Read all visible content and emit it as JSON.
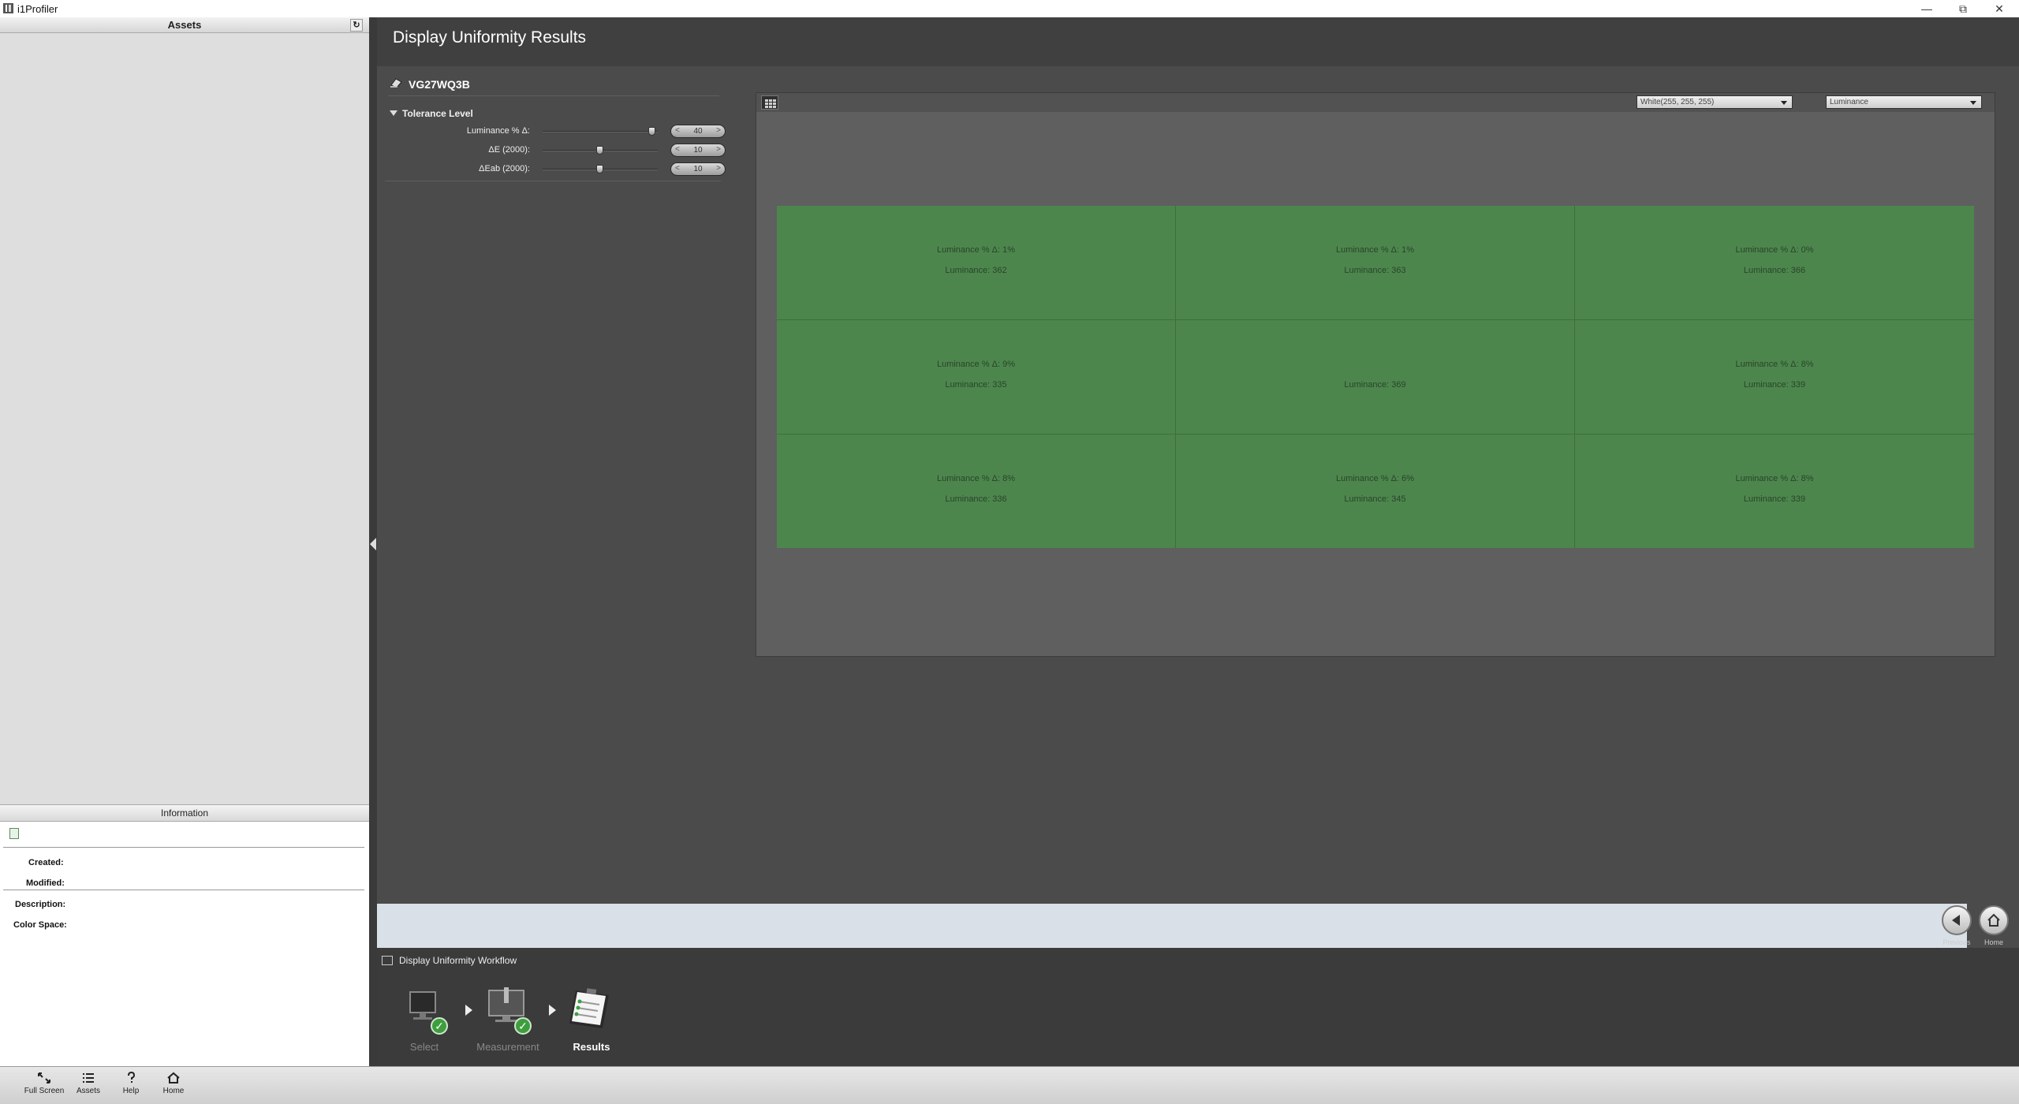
{
  "window": {
    "title": "i1Profiler"
  },
  "left": {
    "assets_header": "Assets",
    "info_header": "Information",
    "info_labels": {
      "created": "Created:",
      "modified": "Modified:",
      "description": "Description:",
      "color_space": "Color Space:"
    }
  },
  "header": {
    "title": "Display Uniformity Results"
  },
  "device": {
    "name": "VG27WQ3B"
  },
  "tolerance": {
    "label": "Tolerance Level",
    "rows": [
      {
        "name": "Luminance % Δ:",
        "value": "40",
        "level": 0.95
      },
      {
        "name": "ΔE (2000):",
        "value": "10",
        "level": 0.5
      },
      {
        "name": "ΔEab (2000):",
        "value": "10",
        "level": 0.5
      }
    ]
  },
  "results": {
    "color_select": "White(255, 255, 255)",
    "metric_select": "Luminance",
    "cells": [
      {
        "delta": "Luminance % Δ:  1%",
        "lum": "Luminance:  362"
      },
      {
        "delta": "Luminance % Δ:  1%",
        "lum": "Luminance:  363"
      },
      {
        "delta": "Luminance % Δ:  0%",
        "lum": "Luminance:  366"
      },
      {
        "delta": "Luminance % Δ:  9%",
        "lum": "Luminance:  335"
      },
      {
        "delta": "",
        "lum": "Luminance:  369"
      },
      {
        "delta": "Luminance % Δ:  8%",
        "lum": "Luminance:  339"
      },
      {
        "delta": "Luminance % Δ:  8%",
        "lum": "Luminance:  336"
      },
      {
        "delta": "Luminance % Δ:  6%",
        "lum": "Luminance:  345"
      },
      {
        "delta": "Luminance % Δ:  8%",
        "lum": "Luminance:  339"
      }
    ],
    "cell_color": "#4d864d"
  },
  "nav": {
    "previous_label": "Previous",
    "home_label": "Home"
  },
  "workflow": {
    "title": "Display Uniformity Workflow",
    "steps": [
      {
        "label": "Select",
        "done": true
      },
      {
        "label": "Measurement",
        "done": true
      },
      {
        "label": "Results",
        "active": true
      }
    ]
  },
  "bottombar": {
    "items": [
      {
        "label": "Full Screen",
        "icon": "fullscreen-icon"
      },
      {
        "label": "Assets",
        "icon": "list-icon"
      },
      {
        "label": "Help",
        "icon": "question-icon"
      },
      {
        "label": "Home",
        "icon": "home-icon"
      }
    ]
  }
}
